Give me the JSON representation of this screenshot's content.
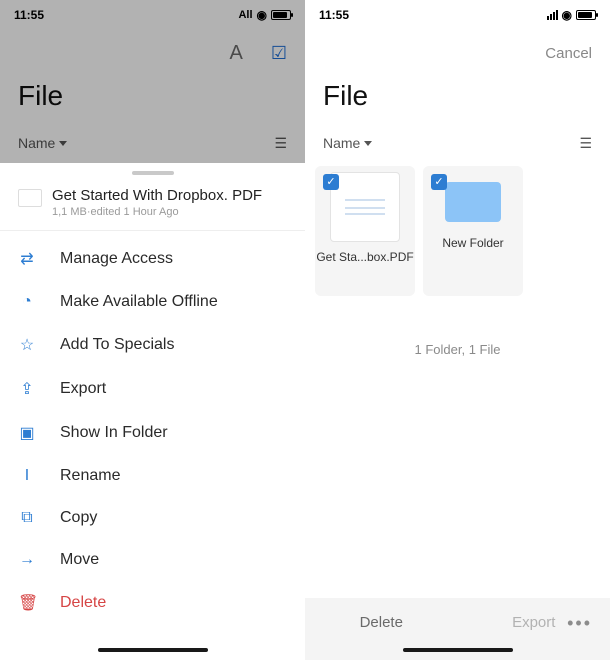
{
  "left": {
    "status": {
      "time": "11:55",
      "carrier": "All"
    },
    "toolbar": {
      "font_label": "A"
    },
    "title": "File",
    "sort": {
      "label": "Name"
    },
    "sheet": {
      "file": {
        "name": "Get Started With Dropbox. PDF",
        "meta": "1,1 MB·edited 1 Hour Ago"
      },
      "items": [
        {
          "icon": "people-icon",
          "glyph": "⇄",
          "label": "Manage Access"
        },
        {
          "icon": "offline-icon",
          "glyph": "◔",
          "label": "Make Available Offline"
        },
        {
          "icon": "star-icon",
          "glyph": "☆",
          "label": "Add To Specials"
        },
        {
          "icon": "export-icon",
          "glyph": "⇪",
          "label": "Export"
        },
        {
          "icon": "folder-icon",
          "glyph": "▣",
          "label": "Show In Folder"
        },
        {
          "icon": "rename-icon",
          "glyph": "I",
          "label": "Rename"
        },
        {
          "icon": "copy-icon",
          "glyph": "⧉",
          "label": "Copy"
        },
        {
          "icon": "move-icon",
          "glyph": "→",
          "label": "Move"
        },
        {
          "icon": "delete-icon",
          "glyph": "🗑",
          "label": "Delete",
          "danger": true
        }
      ]
    }
  },
  "right": {
    "status": {
      "time": "11:55"
    },
    "cancel": "Cancel",
    "title": "File",
    "sort": {
      "label": "Name"
    },
    "tiles": [
      {
        "caption": "Get Sta...box.PDF"
      },
      {
        "caption": "New Folder"
      }
    ],
    "summary": "1 Folder, 1 File",
    "bottom": {
      "delete": "Delete",
      "export": "Export"
    }
  }
}
